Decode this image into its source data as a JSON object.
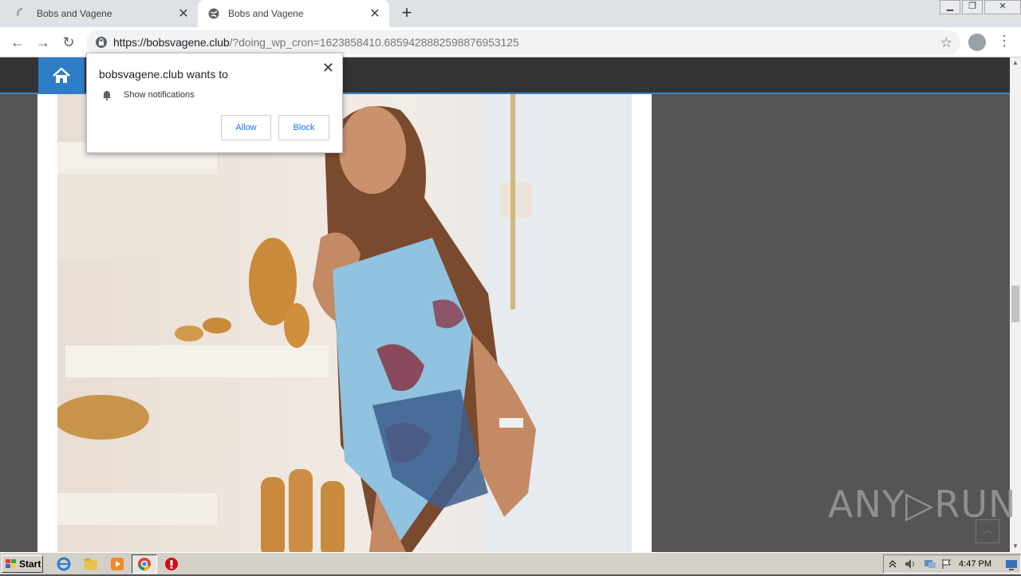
{
  "browser": {
    "tabs": [
      {
        "title": "Bobs and Vagene",
        "state": "loading"
      },
      {
        "title": "Bobs and Vagene",
        "state": "active"
      }
    ],
    "new_tab_label": "+",
    "url_host": "https://bobsvagene.club",
    "url_rest": "/?doing_wp_cron=1623858410.6859428882598876953125"
  },
  "popup": {
    "title": "bobsvagene.club wants to",
    "permission": "Show notifications",
    "allow_label": "Allow",
    "block_label": "Block"
  },
  "watermark": "ANY▷RUN",
  "taskbar": {
    "start_label": "Start",
    "clock": "4:47 PM"
  },
  "colors": {
    "accent": "#2e7cc6",
    "site_header": "#333333",
    "page_bg": "#555555"
  }
}
